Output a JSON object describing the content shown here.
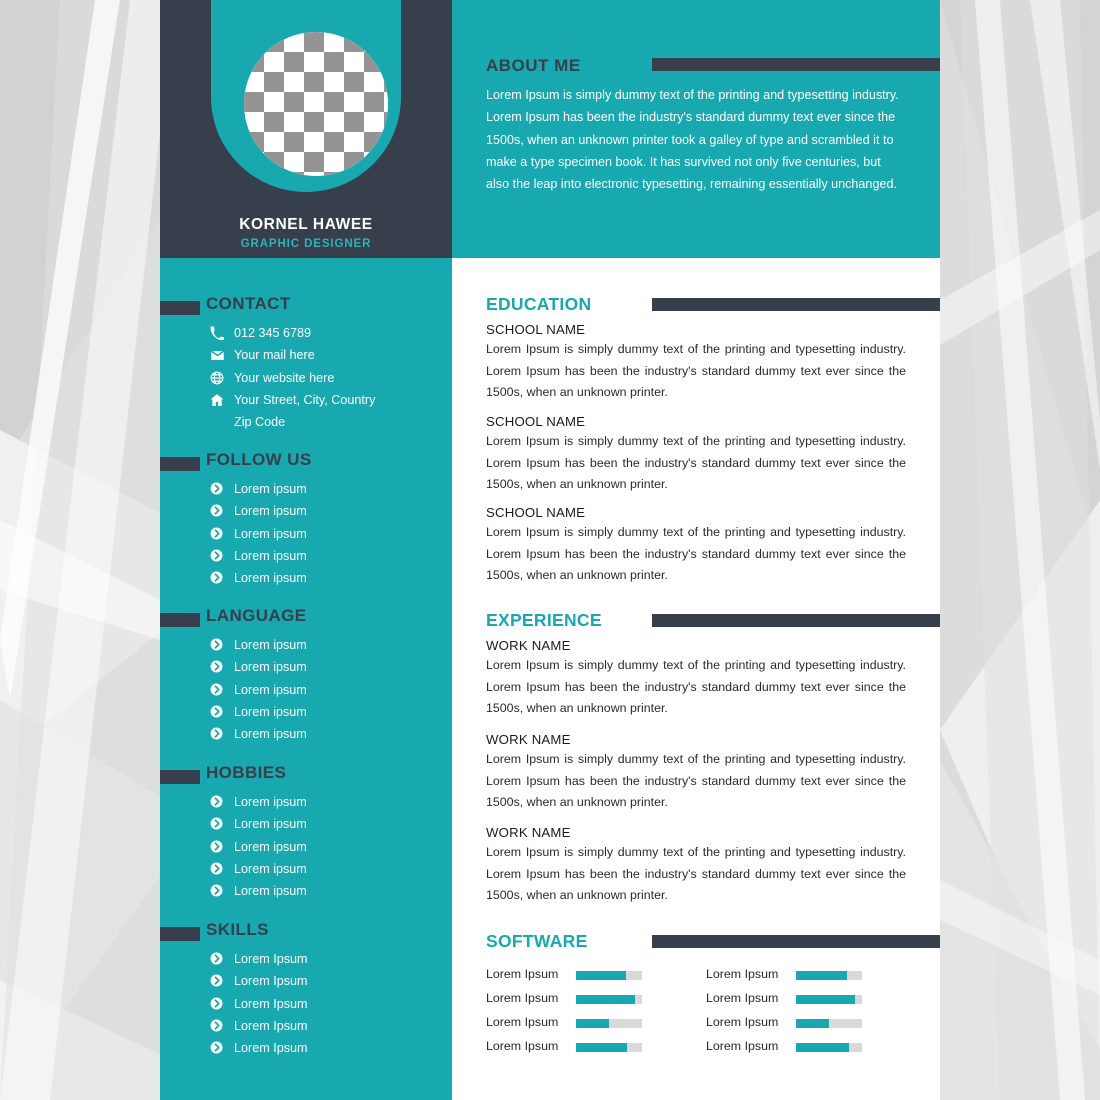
{
  "profile": {
    "name": "KORNEL HAWEE",
    "role": "GRAPHIC DESIGNER",
    "avatar_icon": "image-placeholder-checkerboard"
  },
  "about": {
    "title": "ABOUT ME",
    "text": "Lorem Ipsum is simply dummy text of the printing and typesetting industry. Lorem Ipsum has been the industry's standard dummy text ever since the 1500s, when an unknown printer took a galley of type and scrambled it to make a type specimen book. It has survived not only five centuries, but also the leap into electronic typesetting, remaining essentially unchanged."
  },
  "contact": {
    "title": "CONTACT",
    "items": [
      {
        "icon": "phone-icon",
        "text": "012 345 6789"
      },
      {
        "icon": "envelope-icon",
        "text": "Your mail here"
      },
      {
        "icon": "globe-icon",
        "text": "Your website here"
      },
      {
        "icon": "home-icon",
        "text": "Your Street, City, Country"
      },
      {
        "icon": "none",
        "text": "Zip Code"
      }
    ]
  },
  "follow": {
    "title": "FOLLOW US",
    "items": [
      {
        "icon": "chevron-right-circle-icon",
        "text": "Lorem ipsum"
      },
      {
        "icon": "chevron-right-circle-icon",
        "text": "Lorem ipsum"
      },
      {
        "icon": "chevron-right-circle-icon",
        "text": "Lorem ipsum"
      },
      {
        "icon": "chevron-right-circle-icon",
        "text": "Lorem ipsum"
      },
      {
        "icon": "chevron-right-circle-icon",
        "text": "Lorem ipsum"
      }
    ]
  },
  "language": {
    "title": "LANGUAGE",
    "items": [
      {
        "icon": "chevron-right-circle-icon",
        "text": "Lorem ipsum"
      },
      {
        "icon": "chevron-right-circle-icon",
        "text": "Lorem ipsum"
      },
      {
        "icon": "chevron-right-circle-icon",
        "text": "Lorem ipsum"
      },
      {
        "icon": "chevron-right-circle-icon",
        "text": "Lorem ipsum"
      },
      {
        "icon": "chevron-right-circle-icon",
        "text": "Lorem ipsum"
      }
    ]
  },
  "hobbies": {
    "title": "HOBBIES",
    "items": [
      {
        "icon": "chevron-right-circle-icon",
        "text": "Lorem ipsum"
      },
      {
        "icon": "chevron-right-circle-icon",
        "text": "Lorem ipsum"
      },
      {
        "icon": "chevron-right-circle-icon",
        "text": "Lorem ipsum"
      },
      {
        "icon": "chevron-right-circle-icon",
        "text": "Lorem ipsum"
      },
      {
        "icon": "chevron-right-circle-icon",
        "text": "Lorem ipsum"
      }
    ]
  },
  "skills": {
    "title": "SKILLS",
    "items": [
      {
        "icon": "chevron-right-circle-icon",
        "text": "Lorem Ipsum"
      },
      {
        "icon": "chevron-right-circle-icon",
        "text": "Lorem Ipsum"
      },
      {
        "icon": "chevron-right-circle-icon",
        "text": "Lorem Ipsum"
      },
      {
        "icon": "chevron-right-circle-icon",
        "text": "Lorem Ipsum"
      },
      {
        "icon": "chevron-right-circle-icon",
        "text": "Lorem Ipsum"
      }
    ]
  },
  "education": {
    "title": "EDUCATION",
    "entries": [
      {
        "heading": "SCHOOL NAME",
        "body": "Lorem Ipsum is simply dummy text of the printing and typesetting industry. Lorem Ipsum has been the industry's standard dummy text ever since the 1500s, when an unknown printer."
      },
      {
        "heading": "SCHOOL NAME",
        "body": "Lorem Ipsum is simply dummy text of the printing and typesetting industry. Lorem Ipsum has been the industry's standard dummy text ever since the 1500s, when an unknown printer."
      },
      {
        "heading": "SCHOOL NAME",
        "body": "Lorem Ipsum is simply dummy text of the printing and typesetting industry. Lorem Ipsum has been the industry's standard dummy text ever since the 1500s, when an unknown printer."
      }
    ]
  },
  "experience": {
    "title": "EXPERIENCE",
    "entries": [
      {
        "heading": "WORK NAME",
        "body": "Lorem Ipsum is simply dummy text of the printing and typesetting industry. Lorem Ipsum has been the industry's standard dummy text ever since the 1500s, when an unknown printer."
      },
      {
        "heading": "WORK NAME",
        "body": "Lorem Ipsum is simply dummy text of the printing and typesetting industry. Lorem Ipsum has been the industry's standard dummy text ever since the 1500s, when an unknown printer."
      },
      {
        "heading": "WORK NAME",
        "body": "Lorem Ipsum is simply dummy text of the printing and typesetting industry. Lorem Ipsum has been the industry's standard dummy text ever since the 1500s, when an unknown printer."
      }
    ]
  },
  "software": {
    "title": "SOFTWARE",
    "left_column": [
      {
        "label": "Lorem Ipsum",
        "percent": 75
      },
      {
        "label": "Lorem Ipsum",
        "percent": 90
      },
      {
        "label": "Lorem Ipsum",
        "percent": 50
      },
      {
        "label": "Lorem Ipsum",
        "percent": 78
      }
    ],
    "right_column": [
      {
        "label": "Lorem Ipsum",
        "percent": 77
      },
      {
        "label": "Lorem Ipsum",
        "percent": 90
      },
      {
        "label": "Lorem Ipsum",
        "percent": 50
      },
      {
        "label": "Lorem Ipsum",
        "percent": 80
      }
    ]
  },
  "colors": {
    "teal": "#17a8b0",
    "dark": "#373f4c",
    "role_teal": "#2bb3bb",
    "bar_track": "#d9d9d9",
    "page_white": "#ffffff"
  }
}
